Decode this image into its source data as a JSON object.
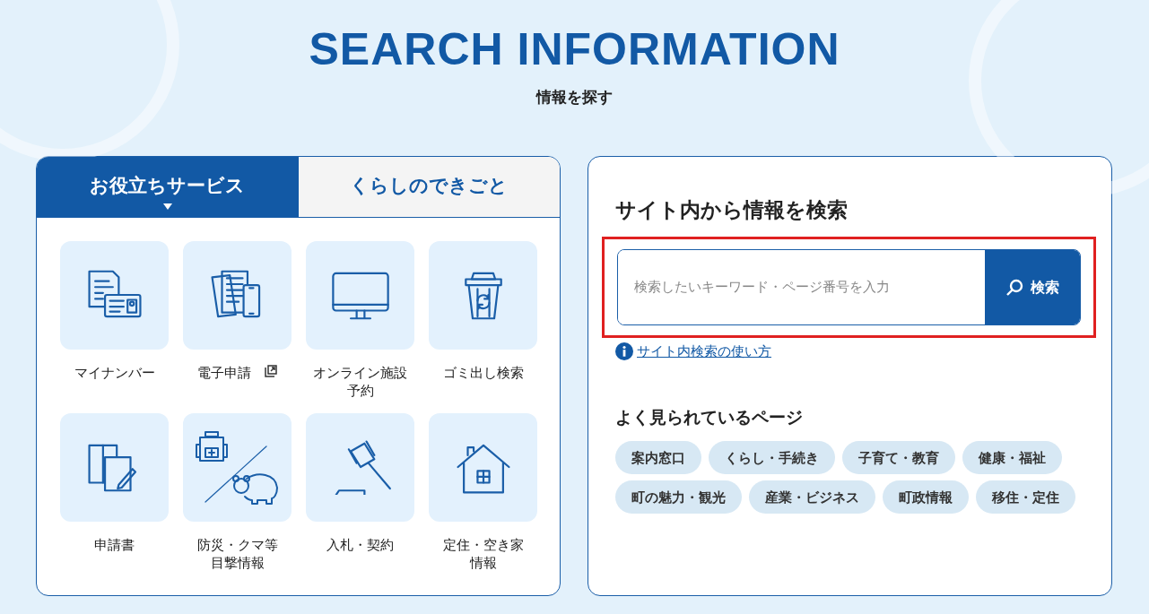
{
  "header": {
    "title": "SEARCH INFORMATION",
    "subtitle": "情報を探す"
  },
  "tabs": [
    {
      "label": "お役立ちサービス",
      "selected": true
    },
    {
      "label": "くらしのできごと",
      "selected": false
    }
  ],
  "services": [
    {
      "kind": "mynumber",
      "label_lines": [
        "マイナンバー"
      ],
      "external": false
    },
    {
      "kind": "eapply",
      "label_lines": [
        "電子申請"
      ],
      "external": true
    },
    {
      "kind": "online",
      "label_lines": [
        "オンライン施設",
        "予約"
      ],
      "external": false
    },
    {
      "kind": "garbage",
      "label_lines": [
        "ゴミ出し検索"
      ],
      "external": false
    },
    {
      "kind": "forms",
      "label_lines": [
        "申請書"
      ],
      "external": false
    },
    {
      "kind": "disaster",
      "label_lines": [
        "防災・クマ等",
        "目撃情報"
      ],
      "external": false
    },
    {
      "kind": "bid",
      "label_lines": [
        "入札・契約"
      ],
      "external": false
    },
    {
      "kind": "house",
      "label_lines": [
        "定住・空き家",
        "情報"
      ],
      "external": false
    }
  ],
  "search": {
    "heading": "サイト内から情報を検索",
    "placeholder": "検索したいキーワード・ページ番号を入力",
    "button": "検索",
    "help_link": "サイト内検索の使い方"
  },
  "popular": {
    "heading": "よく見られているページ",
    "tags": [
      "案内窓口",
      "くらし・手続き",
      "子育て・教育",
      "健康・福祉",
      "町の魅力・観光",
      "産業・ビジネス",
      "町政情報",
      "移住・定住"
    ]
  }
}
